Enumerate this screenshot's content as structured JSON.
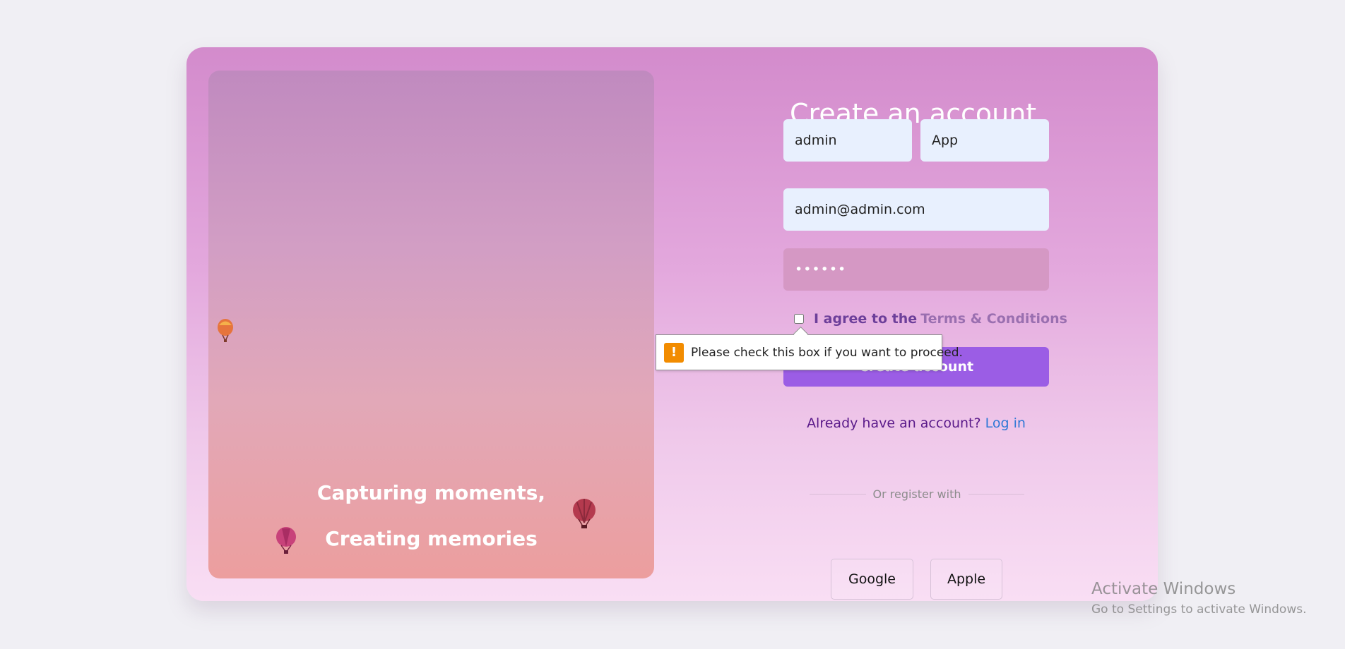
{
  "hero": {
    "line1": "Capturing moments,",
    "line2": "Creating memories"
  },
  "form": {
    "title": "Create an account",
    "first_name_value": "admin",
    "last_name_value": "App",
    "email_value": "admin@admin.com",
    "password_value": "••••••",
    "agree_prefix": "I agree to the",
    "terms_label": "Terms & Conditions",
    "submit_label": "Create account",
    "already_prefix": "Already have an account?",
    "login_label": "Log in",
    "divider_label": "Or register with",
    "google_label": "Google",
    "apple_label": "Apple"
  },
  "validation": {
    "message": "Please check this box if you want to proceed."
  },
  "windows": {
    "line1": "Activate Windows",
    "line2": "Go to Settings to activate Windows."
  },
  "colors": {
    "accent": "#9b5de5",
    "warning": "#f28c00",
    "link": "#2f78d6"
  }
}
